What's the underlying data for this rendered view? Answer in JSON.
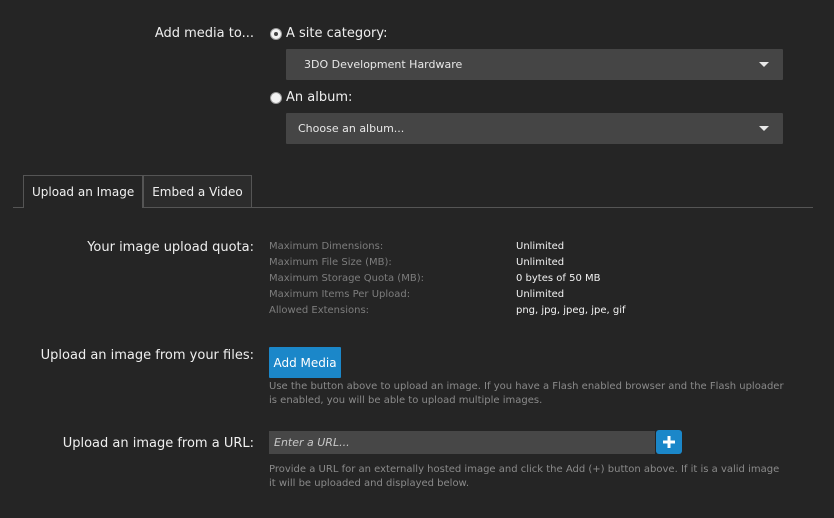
{
  "add_media": {
    "label": "Add media to...",
    "option_category": "A site category:",
    "category_value": "3DO Development Hardware",
    "option_album": "An album:",
    "album_placeholder": "Choose an album..."
  },
  "tabs": [
    {
      "label": "Upload an Image",
      "active": true
    },
    {
      "label": "Embed a Video",
      "active": false
    }
  ],
  "quota": {
    "label": "Your image upload quota:",
    "rows": [
      {
        "name": "Maximum Dimensions:",
        "value": "Unlimited"
      },
      {
        "name": "Maximum File Size (MB):",
        "value": "Unlimited"
      },
      {
        "name": "Maximum Storage Quota (MB):",
        "value": "0 bytes of 50 MB"
      },
      {
        "name": "Maximum Items Per Upload:",
        "value": "Unlimited"
      },
      {
        "name": "Allowed Extensions:",
        "value": "png, jpg, jpeg, jpe, gif"
      }
    ]
  },
  "upload_files": {
    "label": "Upload an image from your files:",
    "button": "Add Media",
    "help": "Use the button above to upload an image. If you have a Flash enabled browser and the Flash uploader is enabled, you will be able to upload multiple images."
  },
  "upload_url": {
    "label": "Upload an image from a URL:",
    "placeholder": "Enter a URL...",
    "add_icon": "plus-icon",
    "help": "Provide a URL for an externally hosted image and click the Add (+) button above. If it is a valid image it will be uploaded and displayed below."
  },
  "colors": {
    "background": "#252525",
    "accent": "#1b87c9",
    "field": "#454545"
  }
}
